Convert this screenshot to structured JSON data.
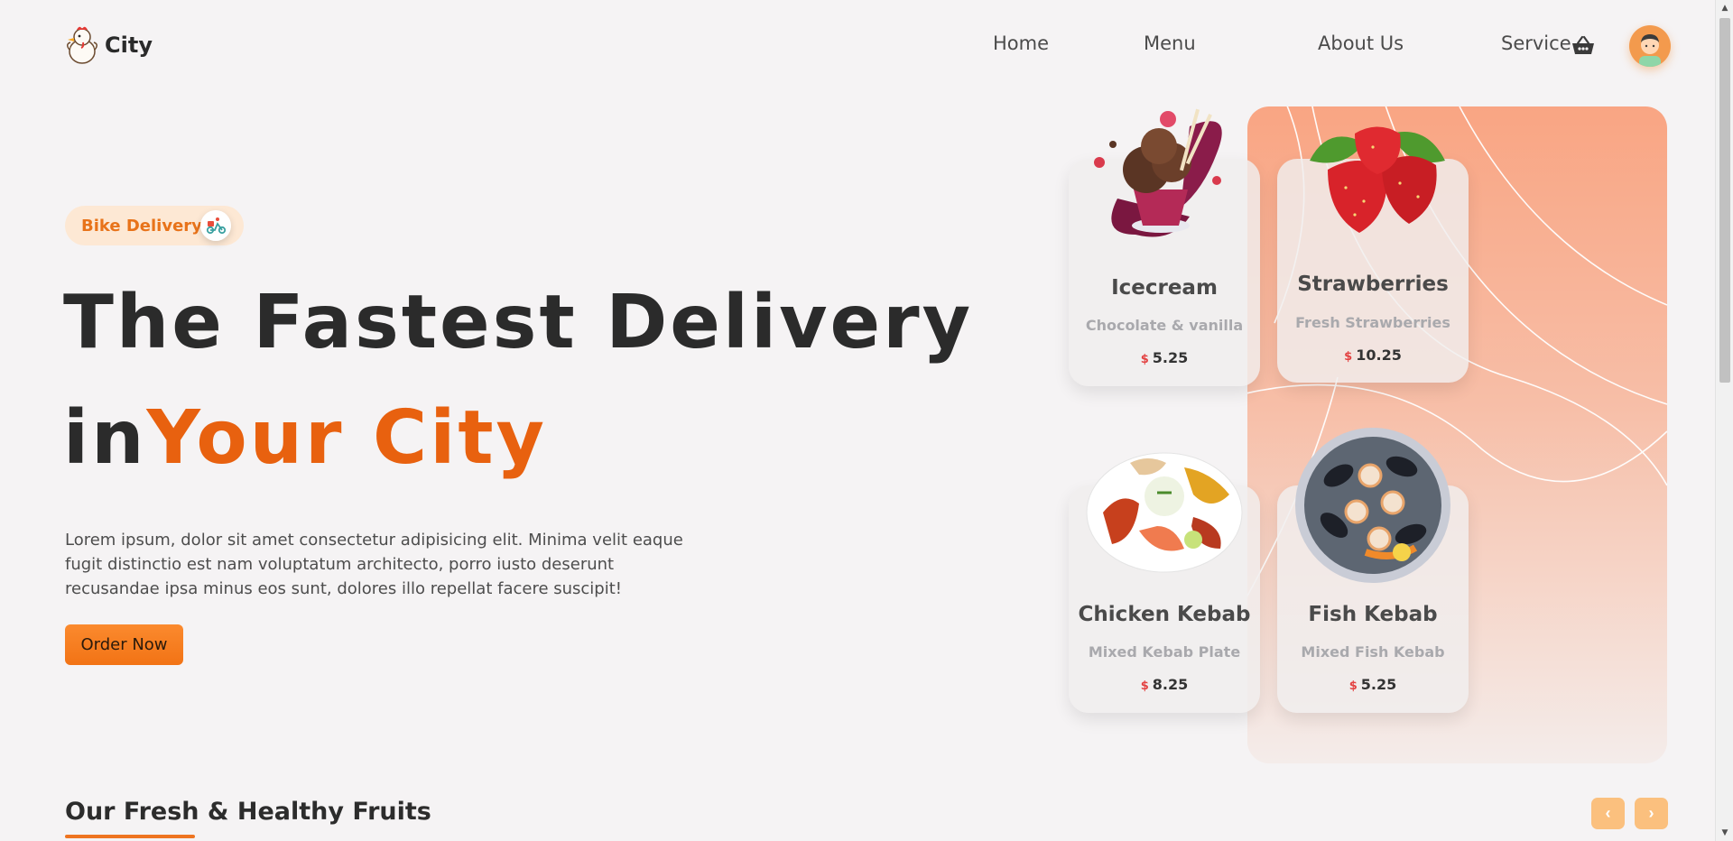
{
  "brand": {
    "name": "City"
  },
  "nav": {
    "items": [
      "Home",
      "Menu",
      "About Us",
      "Service"
    ]
  },
  "hero": {
    "badge": "Bike Delivery",
    "title_line1": "The Fastest Delivery",
    "title_line2_dark": "in",
    "title_line2_accent": "Your City",
    "description": "Lorem ipsum, dolor sit amet consectetur adipisicing elit. Minima velit eaque fugit distinctio est nam voluptatum architecto, porro iusto deserunt recusandae ipsa minus eos sunt, dolores illo repellat facere suscipit!",
    "cta": "Order Now"
  },
  "cards": [
    {
      "name": "Icecream",
      "subtitle": "Chocolate & vanilla",
      "currency": "$",
      "price": "5.25",
      "icon": "icecream-image"
    },
    {
      "name": "Strawberries",
      "subtitle": "Fresh Strawberries",
      "currency": "$",
      "price": "10.25",
      "icon": "strawberries-image"
    },
    {
      "name": "Chicken Kebab",
      "subtitle": "Mixed Kebab Plate",
      "currency": "$",
      "price": "8.25",
      "icon": "chicken-kebab-image"
    },
    {
      "name": "Fish Kebab",
      "subtitle": "Mixed Fish Kebab",
      "currency": "$",
      "price": "5.25",
      "icon": "fish-kebab-image"
    }
  ],
  "section": {
    "title": "Our Fresh & Healthy Fruits",
    "prev_icon": "chevron-left-icon",
    "next_icon": "chevron-right-icon"
  },
  "colors": {
    "accent": "#e8610f",
    "button": "#f27315",
    "panel_top": "#f9a583",
    "price_currency": "#e34242"
  }
}
